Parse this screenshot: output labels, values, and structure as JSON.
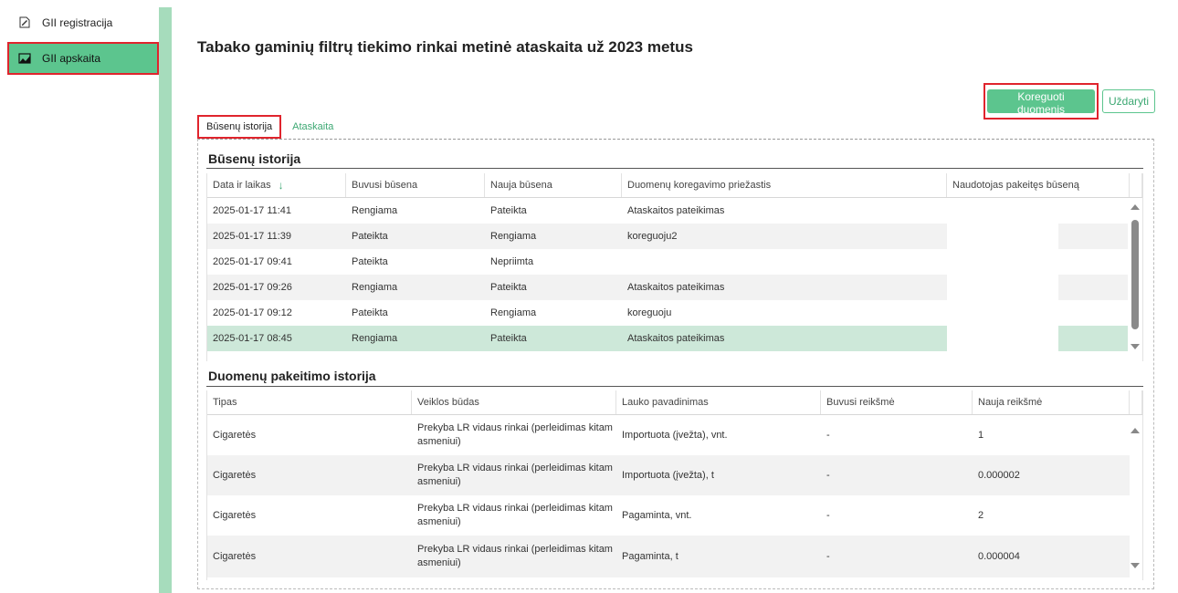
{
  "sidebar": {
    "items": [
      {
        "label": "GII registracija",
        "icon": "edit-document-icon"
      },
      {
        "label": "GII apskaita",
        "icon": "chart-area-icon"
      }
    ]
  },
  "page": {
    "title": "Tabako gaminių filtrų tiekimo rinkai metinė ataskaita už 2023 metus"
  },
  "actions": {
    "edit_label": "Koreguoti duomenis",
    "close_label": "Uždaryti"
  },
  "tabs": [
    {
      "label": "Būsenų istorija",
      "active": true
    },
    {
      "label": "Ataskaita",
      "active": false
    }
  ],
  "status_history": {
    "title": "Būsenų istorija",
    "columns": [
      "Data ir laikas",
      "Buvusi būsena",
      "Nauja būsena",
      "Duomenų koregavimo priežastis",
      "Naudotojas pakeitęs būseną"
    ],
    "sort_icon": "arrow-down-icon",
    "rows": [
      {
        "date": "2025-01-17 11:41",
        "prev": "Rengiama",
        "next": "Pateikta",
        "reason": "Ataskaitos pateikimas",
        "user": ""
      },
      {
        "date": "2025-01-17 11:39",
        "prev": "Pateikta",
        "next": "Rengiama",
        "reason": "koreguoju2",
        "user": ""
      },
      {
        "date": "2025-01-17 09:41",
        "prev": "Pateikta",
        "next": "Nepriimta",
        "reason": "",
        "user": ""
      },
      {
        "date": "2025-01-17 09:26",
        "prev": "Rengiama",
        "next": "Pateikta",
        "reason": "Ataskaitos pateikimas",
        "user": ""
      },
      {
        "date": "2025-01-17 09:12",
        "prev": "Pateikta",
        "next": "Rengiama",
        "reason": "koreguoju",
        "user": ""
      },
      {
        "date": "2025-01-17 08:45",
        "prev": "Rengiama",
        "next": "Pateikta",
        "reason": "Ataskaitos pateikimas",
        "user": "",
        "selected": true
      }
    ]
  },
  "change_history": {
    "title": "Duomenų pakeitimo istorija",
    "columns": [
      "Tipas",
      "Veiklos būdas",
      "Lauko pavadinimas",
      "Buvusi reikšmė",
      "Nauja reikšmė"
    ],
    "rows": [
      {
        "type": "Cigaretės",
        "activity": "Prekyba LR vidaus rinkai (perleidimas kitam asmeniui)",
        "field": "Importuota (įvežta), vnt.",
        "old": "-",
        "new": "1"
      },
      {
        "type": "Cigaretės",
        "activity": "Prekyba LR vidaus rinkai (perleidimas kitam asmeniui)",
        "field": "Importuota (įvežta), t",
        "old": "-",
        "new": "0.000002"
      },
      {
        "type": "Cigaretės",
        "activity": "Prekyba LR vidaus rinkai (perleidimas kitam asmeniui)",
        "field": "Pagaminta, vnt.",
        "old": "-",
        "new": "2"
      },
      {
        "type": "Cigaretės",
        "activity": "Prekyba LR vidaus rinkai (perleidimas kitam asmeniui)",
        "field": "Pagaminta, t",
        "old": "-",
        "new": "0.000004"
      }
    ]
  },
  "colors": {
    "accent": "#5cc58e",
    "highlight": "#e0242d",
    "selected_row": "#cde8d9"
  }
}
